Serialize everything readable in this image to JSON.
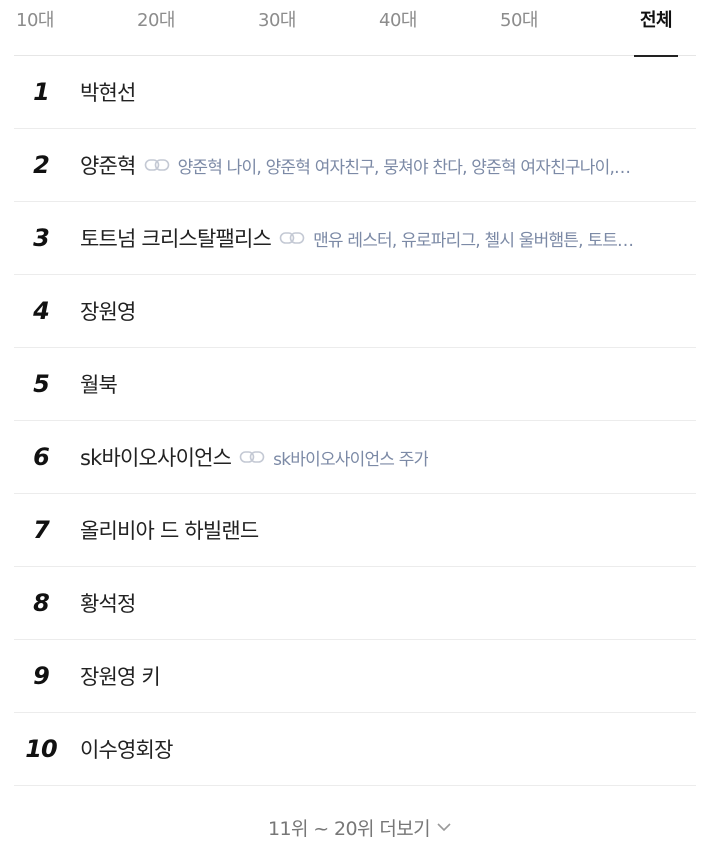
{
  "tabs": [
    {
      "label": "10대",
      "active": false
    },
    {
      "label": "20대",
      "active": false
    },
    {
      "label": "30대",
      "active": false
    },
    {
      "label": "40대",
      "active": false
    },
    {
      "label": "50대",
      "active": false
    },
    {
      "label": "전체",
      "active": true
    }
  ],
  "ranking": [
    {
      "rank": "1",
      "keyword": "박현선",
      "related": ""
    },
    {
      "rank": "2",
      "keyword": "양준혁",
      "related": "양준혁 나이, 양준혁 여자친구, 뭉쳐야 찬다, 양준혁 여자친구나이,…"
    },
    {
      "rank": "3",
      "keyword": "토트넘 크리스탈팰리스",
      "related": "맨유 레스터, 유로파리그, 첼시 울버햄튼, 토트…"
    },
    {
      "rank": "4",
      "keyword": "장원영",
      "related": ""
    },
    {
      "rank": "5",
      "keyword": "월북",
      "related": ""
    },
    {
      "rank": "6",
      "keyword": "sk바이오사이언스",
      "related": "sk바이오사이언스 주가"
    },
    {
      "rank": "7",
      "keyword": "올리비아 드 하빌랜드",
      "related": ""
    },
    {
      "rank": "8",
      "keyword": "황석정",
      "related": ""
    },
    {
      "rank": "9",
      "keyword": "장원영 키",
      "related": ""
    },
    {
      "rank": "10",
      "keyword": "이수영회장",
      "related": ""
    }
  ],
  "more_label": "11위 ~ 20위 더보기",
  "icons": {
    "related_link": "link-icon",
    "more": "chevron-down-icon"
  },
  "colors": {
    "related_text": "#7c8aa6",
    "active_tab": "#111111",
    "inactive_tab": "#8c8c8c"
  }
}
